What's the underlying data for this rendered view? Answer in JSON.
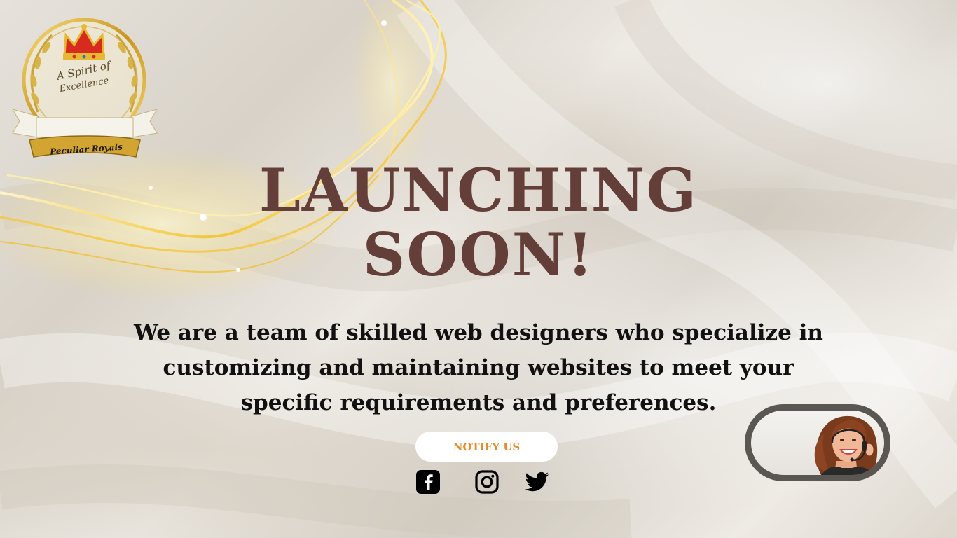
{
  "logo": {
    "line1": "A Spirit of",
    "line2": "Excellence",
    "ribbon": "Peculiar Royals"
  },
  "hero": {
    "headline": "LAUNCHING SOON!",
    "description": "We are a team of skilled web designers who specialize in customizing and maintaining websites to meet your specific requirements and preferences."
  },
  "cta": {
    "notify_label": "NOTIFY US"
  },
  "social": {
    "icons": [
      "facebook-icon",
      "instagram-icon",
      "twitter-icon"
    ]
  },
  "support": {
    "icon": "support-agent-avatar"
  },
  "colors": {
    "headline": "#643f3a",
    "description": "#111111",
    "notify_text": "#e98b28",
    "notify_bg": "#ffffff",
    "gold": "#e8b628",
    "widget_border": "#5a5753"
  }
}
